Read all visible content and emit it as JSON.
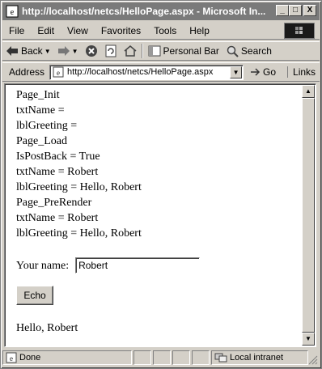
{
  "window": {
    "title": "http://localhost/netcs/HelloPage.aspx - Microsoft In...",
    "minimize_glyph": "_",
    "maximize_glyph": "□",
    "close_glyph": "X"
  },
  "menu": {
    "items": [
      "File",
      "Edit",
      "View",
      "Favorites",
      "Tools",
      "Help"
    ]
  },
  "toolbar": {
    "back_label": "Back",
    "personal_bar_label": "Personal Bar",
    "search_label": "Search"
  },
  "address": {
    "label": "Address",
    "url": "http://localhost/netcs/HelloPage.aspx",
    "go_label": "Go",
    "links_label": "Links"
  },
  "page": {
    "trace": [
      "Page_Init",
      "txtName =",
      "lblGreeting =",
      "Page_Load",
      "IsPostBack = True",
      "txtName = Robert",
      "lblGreeting = Hello, Robert",
      "Page_PreRender",
      "txtName = Robert",
      "lblGreeting = Hello, Robert"
    ],
    "name_label": "Your name:",
    "name_value": "Robert",
    "echo_label": "Echo",
    "greeting": "Hello, Robert"
  },
  "status": {
    "text": "Done",
    "zone": "Local intranet"
  }
}
